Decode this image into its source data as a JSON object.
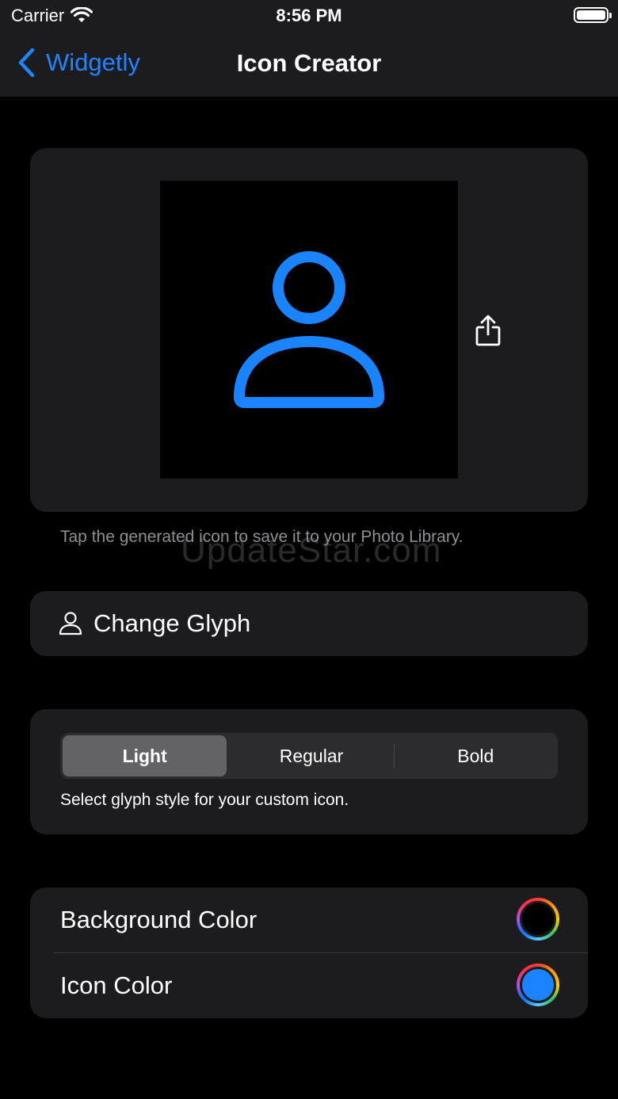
{
  "status": {
    "carrier": "Carrier",
    "time": "8:56 PM"
  },
  "nav": {
    "back_label": "Widgetly",
    "title": "Icon Creator"
  },
  "preview": {
    "hint": "Tap the generated icon to save it to your Photo Library.",
    "watermark": "UpdateStar.com",
    "icon_color": "#1a84ff",
    "icon_background": "#000000"
  },
  "glyph": {
    "label": "Change Glyph"
  },
  "style": {
    "segments": [
      "Light",
      "Regular",
      "Bold"
    ],
    "selected": "Light",
    "note": "Select glyph style for your custom icon."
  },
  "colors": {
    "background_label": "Background Color",
    "background_value": "#000000",
    "icon_label": "Icon Color",
    "icon_value": "#1a84ff"
  },
  "theme": {
    "accent": "#1f84ff",
    "card": "#1c1c1e"
  }
}
